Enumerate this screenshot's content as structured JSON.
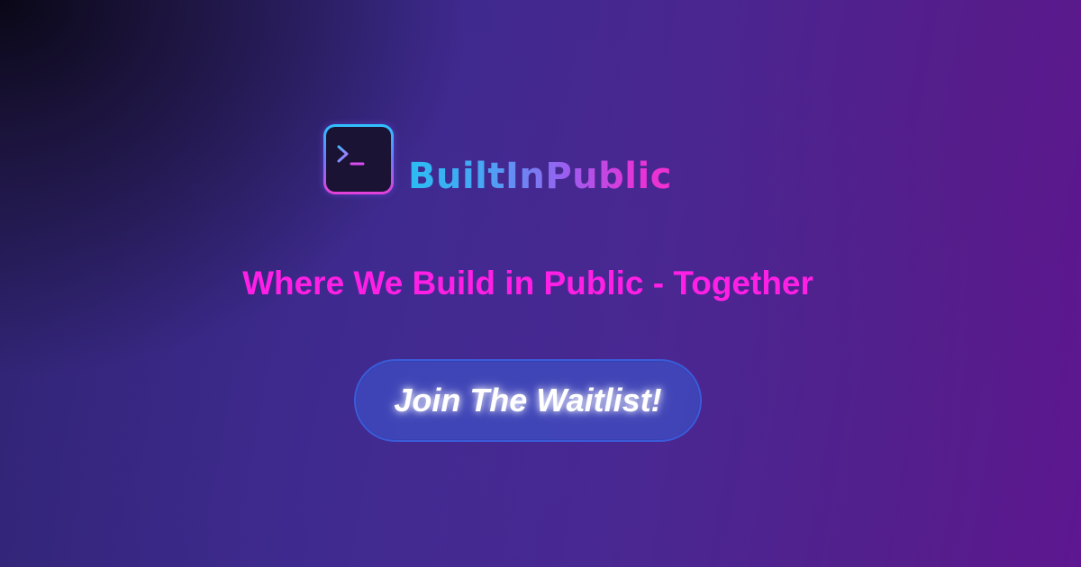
{
  "logo": {
    "icon": "terminal-prompt-icon",
    "brand_name": "BuiltInPublic"
  },
  "tagline": "Where We Build in Public - Together",
  "cta": {
    "label": "Join The Waitlist!"
  },
  "colors": {
    "tagline": "#ff1fe5",
    "brand_gradient_start": "#2bbdf2",
    "brand_gradient_end": "#f030d0",
    "button_fill": "#3e4abe",
    "button_text": "#ffffff"
  }
}
